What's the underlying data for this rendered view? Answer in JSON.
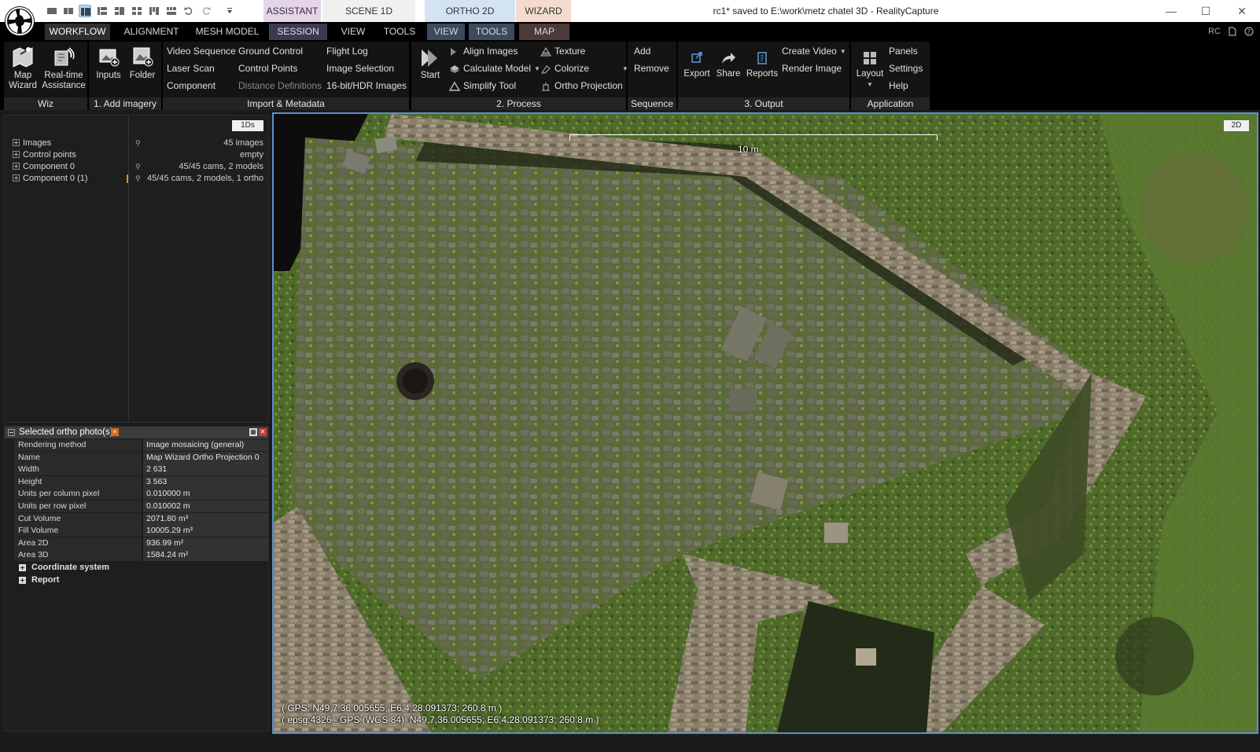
{
  "titlebar": {
    "context_tabs": [
      "ASSISTANT",
      "SCENE 1D",
      "ORTHO 2D",
      "WIZARD"
    ],
    "window_title": "rc1* saved to E:\\work\\metz chatel 3D - RealityCapture",
    "minimize": "—",
    "maximize": "☐",
    "close": "✕"
  },
  "menu": {
    "tabs": [
      "WORKFLOW",
      "ALIGNMENT",
      "MESH MODEL",
      "SESSION",
      "VIEW",
      "TOOLS",
      "VIEW",
      "TOOLS",
      "MAP"
    ],
    "right_rc": "RC"
  },
  "ribbon": {
    "wiz": {
      "label": "Wiz",
      "map_wizard_1": "Map",
      "map_wizard_2": "Wizard",
      "realtime_1": "Real-time",
      "realtime_2": "Assistance"
    },
    "add_imagery": {
      "label": "1. Add imagery",
      "inputs": "Inputs",
      "folder": "Folder"
    },
    "import_metadata": {
      "label": "Import & Metadata",
      "col1": [
        "Video Sequence",
        "Laser Scan",
        "Component"
      ],
      "col2": [
        "Ground Control",
        "Control Points",
        "Distance Definitions"
      ],
      "col3": [
        "Flight Log",
        "Image Selection",
        "16-bit/HDR Images"
      ]
    },
    "process": {
      "label": "2. Process",
      "start": "Start",
      "col1": [
        "Align Images",
        "Calculate Model",
        "Simplify Tool"
      ],
      "col2": [
        "Texture",
        "Colorize",
        "Ortho Projection"
      ]
    },
    "sequence": {
      "label": "Sequence",
      "add": "Add",
      "remove": "Remove"
    },
    "output": {
      "label": "3. Output",
      "export": "Export",
      "share": "Share",
      "reports": "Reports",
      "create_video": "Create Video",
      "render_image": "Render Image"
    },
    "application": {
      "label": "Application",
      "layout": "Layout",
      "items": [
        "Panels",
        "Settings",
        "Help"
      ]
    }
  },
  "tree": {
    "button_1ds": "1Ds",
    "items": [
      {
        "label": "Images",
        "info": "45 images"
      },
      {
        "label": "Control points",
        "info": "empty"
      },
      {
        "label": "Component 0",
        "info": "45/45 cams, 2 models"
      },
      {
        "label": "Component 0 (1)",
        "info": "45/45 cams, 2 models, 1 ortho"
      }
    ]
  },
  "properties": {
    "title": "Selected ortho photo(s)",
    "badge": "×",
    "rows": [
      {
        "k": "Rendering method",
        "v": "Image mosaicing (general)"
      },
      {
        "k": "Name",
        "v": "Map Wizard Ortho Projection 0"
      },
      {
        "k": "Width",
        "v": "2 631"
      },
      {
        "k": "Height",
        "v": "3 563"
      },
      {
        "k": "Units per column pixel",
        "v": "0.010000 m"
      },
      {
        "k": "Units per row pixel",
        "v": "0.010002 m"
      },
      {
        "k": "Cut Volume",
        "v": "2071.80 m³"
      },
      {
        "k": "Fill Volume",
        "v": "10005.29 m³"
      },
      {
        "k": "Area 2D",
        "v": "936.99 m²"
      },
      {
        "k": "Area 3D",
        "v": "1584.24 m²"
      }
    ],
    "groups": [
      "Coordinate system",
      "Report"
    ]
  },
  "viewport": {
    "button_2d": "2D",
    "scale_label": "10 m",
    "gps_line1": "( GPS: N49,7,36.005655; E6,4,28.091373; 260.8 m )",
    "gps_line2": "( epsg:4326 - GPS (WGS 84): N49,7,36.005655; E6,4,28.091373; 260.8 m )"
  }
}
